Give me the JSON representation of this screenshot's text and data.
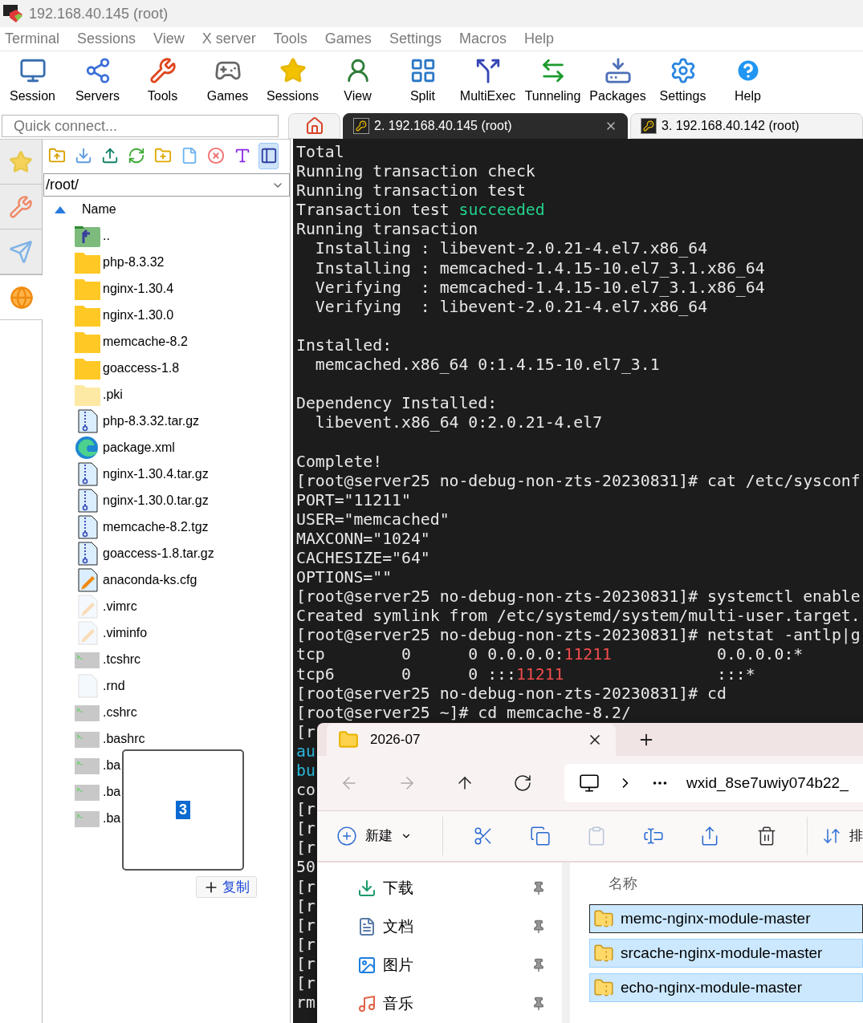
{
  "window": {
    "title": "192.168.40.145 (root)"
  },
  "menu": [
    "Terminal",
    "Sessions",
    "View",
    "X server",
    "Tools",
    "Games",
    "Settings",
    "Macros",
    "Help"
  ],
  "toolbar": [
    "Session",
    "Servers",
    "Tools",
    "Games",
    "Sessions",
    "View",
    "Split",
    "MultiExec",
    "Tunneling",
    "Packages",
    "Settings",
    "Help"
  ],
  "quick_connect": {
    "placeholder": "Quick connect..."
  },
  "session_tabs": [
    {
      "kind": "home",
      "selected": false
    },
    {
      "kind": "session",
      "label": "2. 192.168.40.145 (root)",
      "selected": true,
      "closable": true
    },
    {
      "kind": "session",
      "label": "3. 192.168.40.142 (root)",
      "selected": false,
      "closable": false
    }
  ],
  "side_tabs": [
    {
      "selected": false
    },
    {
      "selected": false
    },
    {
      "selected": false
    },
    {
      "selected": true
    }
  ],
  "file_browser": {
    "toolbar": [
      {
        "selected": false
      },
      {
        "selected": false
      },
      {
        "selected": false
      },
      {
        "selected": false
      },
      {
        "selected": false
      },
      {
        "selected": false
      },
      {
        "selected": false
      },
      {
        "selected": false
      },
      {
        "selected": true
      }
    ],
    "path": "/root/",
    "column": "Name",
    "sorted_ascending": true,
    "files": [
      {
        "name": "..",
        "kind": "up"
      },
      {
        "name": "php-8.3.32",
        "kind": "folder"
      },
      {
        "name": "nginx-1.30.4",
        "kind": "folder"
      },
      {
        "name": "nginx-1.30.0",
        "kind": "folder"
      },
      {
        "name": "memcache-8.2",
        "kind": "folder"
      },
      {
        "name": "goaccess-1.8",
        "kind": "folder"
      },
      {
        "name": ".pki",
        "kind": "hidden-folder"
      },
      {
        "name": "php-8.3.32.tar.gz",
        "kind": "archive"
      },
      {
        "name": "package.xml",
        "kind": "web"
      },
      {
        "name": "nginx-1.30.4.tar.gz",
        "kind": "archive"
      },
      {
        "name": "nginx-1.30.0.tar.gz",
        "kind": "archive"
      },
      {
        "name": "memcache-8.2.tgz",
        "kind": "archive"
      },
      {
        "name": "goaccess-1.8.tar.gz",
        "kind": "archive"
      },
      {
        "name": "anaconda-ks.cfg",
        "kind": "config"
      },
      {
        "name": ".vimrc",
        "kind": "hidden-config"
      },
      {
        "name": ".viminfo",
        "kind": "hidden-config"
      },
      {
        "name": ".tcshrc",
        "kind": "shell"
      },
      {
        "name": ".rnd",
        "kind": "file"
      },
      {
        "name": ".cshrc",
        "kind": "shell"
      },
      {
        "name": ".bashrc",
        "kind": "shell"
      },
      {
        "name": ".ba",
        "kind": "shell"
      },
      {
        "name": ".ba",
        "kind": "shell"
      },
      {
        "name": ".ba",
        "kind": "shell"
      }
    ]
  },
  "terminal": {
    "lines": [
      {
        "kind": "text",
        "segments": [
          {
            "text": "Total"
          }
        ]
      },
      {
        "kind": "text",
        "segments": [
          {
            "text": "Running transaction check"
          }
        ]
      },
      {
        "kind": "text",
        "segments": [
          {
            "text": "Running transaction test"
          }
        ]
      },
      {
        "kind": "text",
        "segments": [
          {
            "text": "Transaction test "
          },
          {
            "text": "succeeded",
            "color": "#23d18b"
          }
        ]
      },
      {
        "kind": "text",
        "segments": [
          {
            "text": "Running transaction"
          }
        ]
      },
      {
        "kind": "text",
        "segments": [
          {
            "text": "  Installing : libevent-2.0.21-4.el7.x86_64"
          }
        ]
      },
      {
        "kind": "text",
        "segments": [
          {
            "text": "  Installing : memcached-1.4.15-10.el7_3.1.x86_64"
          }
        ]
      },
      {
        "kind": "text",
        "segments": [
          {
            "text": "  Verifying  : memcached-1.4.15-10.el7_3.1.x86_64"
          }
        ]
      },
      {
        "kind": "text",
        "segments": [
          {
            "text": "  Verifying  : libevent-2.0.21-4.el7.x86_64"
          }
        ]
      },
      {
        "kind": "blank"
      },
      {
        "kind": "text",
        "segments": [
          {
            "text": "Installed:"
          }
        ]
      },
      {
        "kind": "text",
        "segments": [
          {
            "text": "  memcached.x86_64 0:1.4.15-10.el7_3.1"
          }
        ]
      },
      {
        "kind": "blank"
      },
      {
        "kind": "text",
        "segments": [
          {
            "text": "Dependency Installed:"
          }
        ]
      },
      {
        "kind": "text",
        "segments": [
          {
            "text": "  libevent.x86_64 0:2.0.21-4.el7"
          }
        ]
      },
      {
        "kind": "blank"
      },
      {
        "kind": "text",
        "segments": [
          {
            "text": "Complete!"
          }
        ]
      },
      {
        "kind": "text",
        "segments": [
          {
            "text": "[root@server25 no-debug-non-zts-20230831]# cat /etc/sysconf"
          }
        ]
      },
      {
        "kind": "text",
        "segments": [
          {
            "text": "PORT=\"11211\""
          }
        ]
      },
      {
        "kind": "text",
        "segments": [
          {
            "text": "USER=\"memcached\""
          }
        ]
      },
      {
        "kind": "text",
        "segments": [
          {
            "text": "MAXCONN=\"1024\""
          }
        ]
      },
      {
        "kind": "text",
        "segments": [
          {
            "text": "CACHESIZE=\"64\""
          }
        ]
      },
      {
        "kind": "text",
        "segments": [
          {
            "text": "OPTIONS=\"\""
          }
        ]
      },
      {
        "kind": "text",
        "segments": [
          {
            "text": "[root@server25 no-debug-non-zts-20230831]# systemctl enable"
          }
        ]
      },
      {
        "kind": "text",
        "segments": [
          {
            "text": "Created symlink from /etc/systemd/system/multi-user.target."
          }
        ]
      },
      {
        "kind": "text",
        "segments": [
          {
            "text": "[root@server25 no-debug-non-zts-20230831]# netstat -antlp|g"
          }
        ]
      },
      {
        "kind": "text",
        "segments": [
          {
            "text": "tcp        0      0 0.0.0.0:"
          },
          {
            "text": "11211",
            "color": "#f14c4c"
          },
          {
            "text": "           0.0.0.0:*"
          }
        ]
      },
      {
        "kind": "text",
        "segments": [
          {
            "text": "tcp6       0      0 :::"
          },
          {
            "text": "11211",
            "color": "#f14c4c"
          },
          {
            "text": "                :::*"
          }
        ]
      },
      {
        "kind": "text",
        "segments": [
          {
            "text": "[root@server25 no-debug-non-zts-20230831]# cd"
          }
        ]
      },
      {
        "kind": "text",
        "segments": [
          {
            "text": "[root@server25 ~]# cd memcache-8.2/"
          }
        ]
      },
      {
        "kind": "text",
        "segments": [
          {
            "text": "[r"
          }
        ]
      },
      {
        "kind": "text",
        "segments": [
          {
            "text": "au",
            "color": "#29b8db"
          }
        ]
      },
      {
        "kind": "text",
        "segments": [
          {
            "text": "bu",
            "color": "#29b8db"
          }
        ]
      },
      {
        "kind": "text",
        "segments": [
          {
            "text": "co"
          }
        ]
      },
      {
        "kind": "text",
        "segments": [
          {
            "text": "[r"
          }
        ]
      },
      {
        "kind": "text",
        "segments": [
          {
            "text": "[r"
          }
        ]
      },
      {
        "kind": "text",
        "segments": [
          {
            "text": "[r"
          }
        ]
      },
      {
        "kind": "text",
        "segments": [
          {
            "text": "50"
          }
        ]
      },
      {
        "kind": "text",
        "segments": [
          {
            "text": "[r"
          }
        ]
      },
      {
        "kind": "text",
        "segments": [
          {
            "text": "[r"
          }
        ]
      },
      {
        "kind": "text",
        "segments": [
          {
            "text": "[r"
          }
        ]
      },
      {
        "kind": "text",
        "segments": [
          {
            "text": "[r"
          }
        ]
      },
      {
        "kind": "text",
        "segments": [
          {
            "text": "[r"
          }
        ]
      },
      {
        "kind": "text",
        "segments": [
          {
            "text": "[r"
          }
        ]
      },
      {
        "kind": "text",
        "segments": [
          {
            "text": "rm"
          }
        ]
      }
    ]
  },
  "popup": {
    "badge": "3"
  },
  "copy_button": {
    "label": "复制"
  },
  "explorer": {
    "tabs": [
      {
        "label": "2026-07",
        "selected": true
      }
    ],
    "nav_buttons": [
      {
        "disabled": true
      },
      {
        "disabled": true
      },
      {
        "disabled": false
      },
      {
        "disabled": false
      }
    ],
    "address": "wxid_8se7uwiy074b22_",
    "new_button": "新建",
    "actions": [
      {
        "disabled": false
      },
      {
        "disabled": false
      },
      {
        "disabled": true
      },
      {
        "disabled": false
      },
      {
        "disabled": false
      },
      {
        "disabled": false
      }
    ],
    "sort_button": "排",
    "quick_access": [
      {
        "label": "下载",
        "pinned": true
      },
      {
        "label": "文档",
        "pinned": true
      },
      {
        "label": "图片",
        "pinned": true
      },
      {
        "label": "音乐",
        "pinned": true
      }
    ],
    "column": "名称",
    "items": [
      {
        "name": "memc-nginx-module-master",
        "selected": true,
        "focused": true
      },
      {
        "name": "srcache-nginx-module-master",
        "selected": true,
        "focused": false
      },
      {
        "name": "echo-nginx-module-master",
        "selected": true,
        "focused": false
      }
    ]
  }
}
